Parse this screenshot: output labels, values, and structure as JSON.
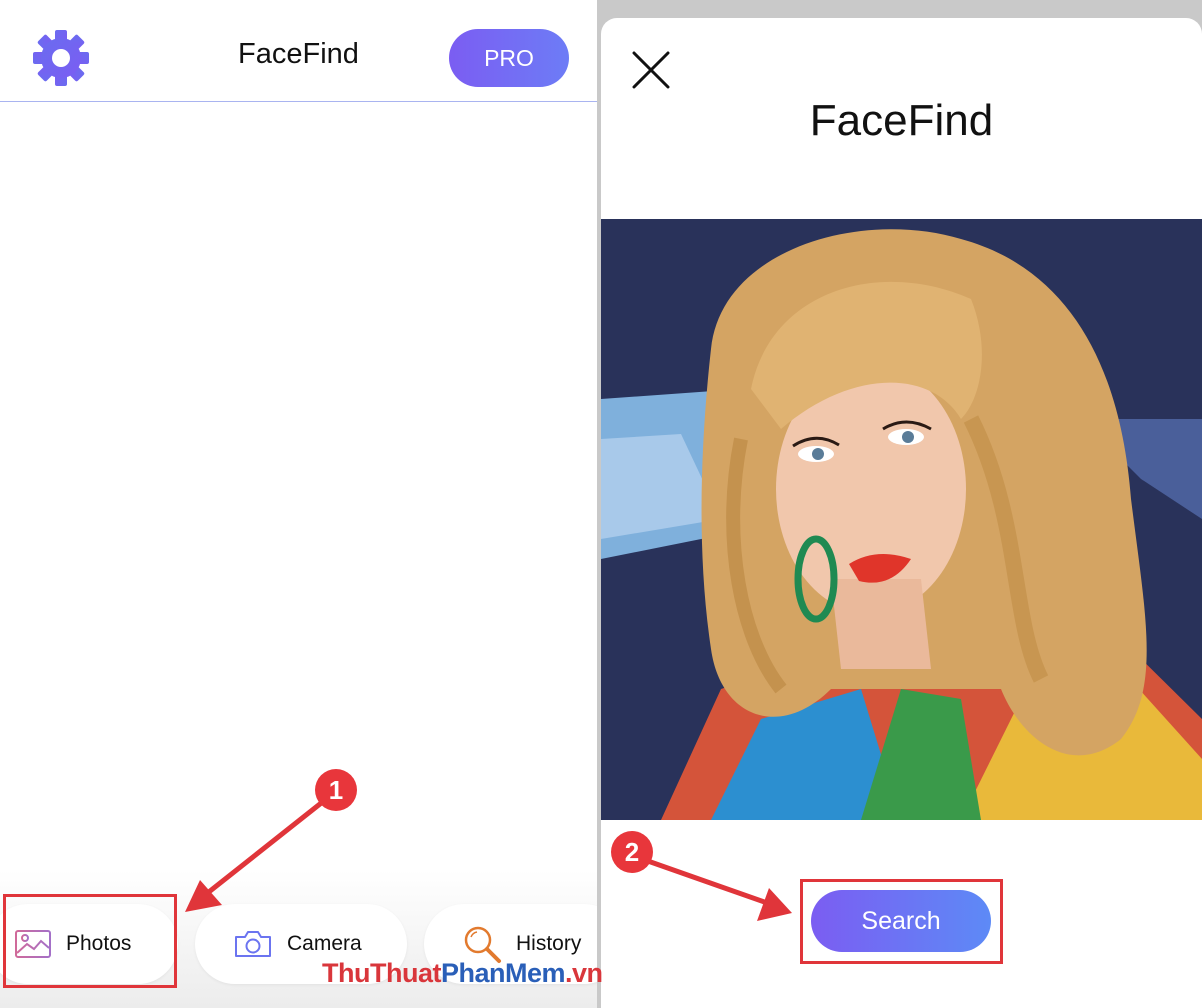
{
  "left_screen": {
    "header": {
      "title": "FaceFind",
      "pro_label": "PRO"
    },
    "nav": {
      "photos_label": "Photos",
      "camera_label": "Camera",
      "history_label": "History"
    }
  },
  "right_screen": {
    "title": "FaceFind",
    "search_label": "Search"
  },
  "annotations": {
    "step1": "1",
    "step2": "2"
  },
  "watermark": {
    "part1": "ThuThuat",
    "part2": "PhanMem",
    "part3": ".vn"
  },
  "colors": {
    "accent_purple": "#7b5df2",
    "accent_blue": "#5d8af6",
    "highlight_red": "#e0353a"
  },
  "icons": [
    "gear-icon",
    "photos-icon",
    "camera-icon",
    "history-icon",
    "close-icon"
  ]
}
